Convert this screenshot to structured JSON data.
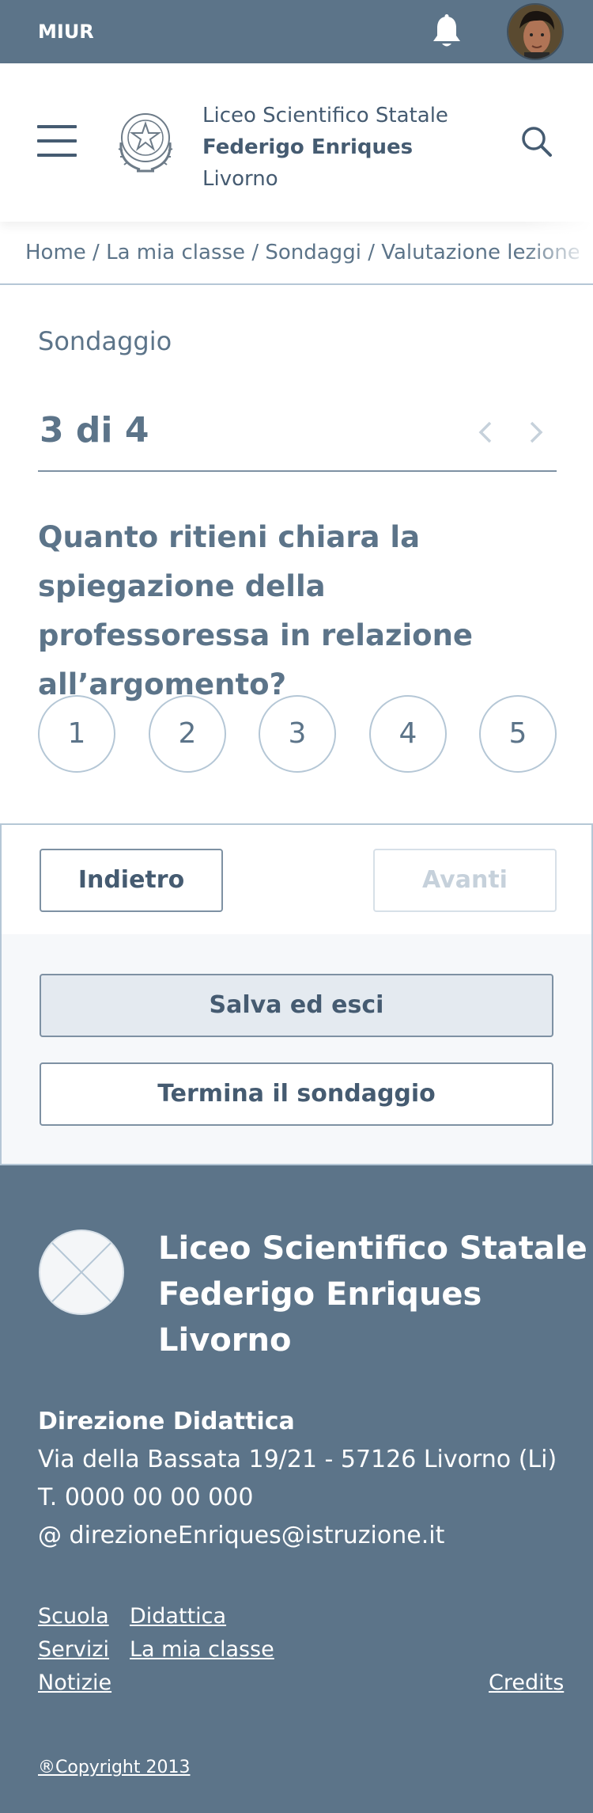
{
  "topbar": {
    "brand": "MIUR",
    "bell_icon": "bell-icon",
    "avatar": "user-avatar"
  },
  "header": {
    "menu_icon": "hamburger-icon",
    "emblem": "italian-republic-emblem",
    "school_line1": "Liceo Scientifico Statale",
    "school_line2": "Federigo Enriques",
    "school_line3": "Livorno",
    "search_icon": "search-icon"
  },
  "breadcrumb": {
    "items": [
      "Home",
      "La mia classe",
      "Sondaggi",
      "Valutazione lezione di classe"
    ],
    "separator": "/"
  },
  "survey": {
    "label": "Sondaggio",
    "step": "3 di 4",
    "question": "Quanto ritieni chiara la spiegazione della professoressa in relazione all’argomento?",
    "options": [
      "1",
      "2",
      "3",
      "4",
      "5"
    ]
  },
  "nav": {
    "back": "Indietro",
    "next": "Avanti"
  },
  "actions": {
    "save": "Salva ed esci",
    "end": "Termina il sondaggio"
  },
  "footer": {
    "title_line1": "Liceo Scientifico Statale",
    "title_line2": "Federigo Enriques",
    "title_line3": "Livorno",
    "contact_head": "Direzione Didattica",
    "address": "Via della Bassata 19/21 - 57126 Livorno (Li)",
    "phone": "T. 0000 00 00 000",
    "email": "@ direzioneEnriques@istruzione.it",
    "links": {
      "scuola": "Scuola",
      "didattica": "Didattica",
      "servizi": "Servizi",
      "mia_classe": "La mia classe",
      "notizie": "Notizie",
      "credits": "Credits"
    },
    "copyright": "®Copyright 2013"
  },
  "colors": {
    "primary": "#5c7489",
    "text": "#455b71",
    "border": "#b5c7d6",
    "muted": "#c6d1db"
  }
}
